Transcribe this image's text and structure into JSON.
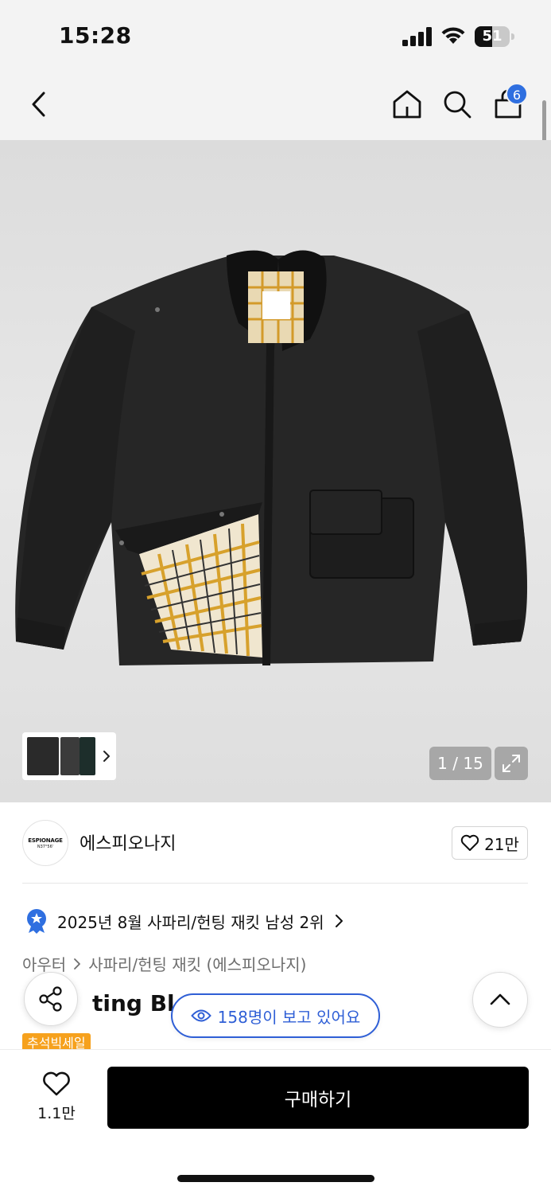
{
  "status_bar": {
    "time": "15:28",
    "battery": "51",
    "battery_level": 0.51
  },
  "nav": {
    "back_icon": "chevron-left-icon",
    "home_icon": "home-icon",
    "search_icon": "search-icon",
    "cart_icon": "shopping-bag-icon",
    "cart_count": "6"
  },
  "gallery": {
    "counter": "1 / 15",
    "current": 1,
    "total": 15,
    "fullscreen_icon": "expand-icon",
    "thumbnail_more_icon": "chevron-right-icon"
  },
  "brand": {
    "logo_text": "ESPIONAGE",
    "logo_sub": "N37°56'",
    "name": "에스피오나지",
    "likes": "21만"
  },
  "ranking": {
    "icon": "ranking-medal-icon",
    "text": "2025년 8월 사파리/헌팅 재킷 남성 2위"
  },
  "breadcrumb": {
    "level1": "아우터",
    "level2": "사파리/헌팅 재킷 (에스피오나지)"
  },
  "product": {
    "title_visible": "ting Blou",
    "sale_tag": "추석빅세일"
  },
  "viewers": {
    "text": "158명이 보고 있어요",
    "icon": "eye-icon"
  },
  "floating": {
    "share_icon": "share-icon",
    "top_icon": "chevron-up-icon"
  },
  "bottom": {
    "wish_count": "1.1만",
    "wish_icon": "heart-icon",
    "buy_label": "구매하기"
  },
  "colors": {
    "accent_blue": "#2f5fd6",
    "badge_blue": "#2f6fe0",
    "sale_orange": "#f6a11d",
    "buy_black": "#000000"
  }
}
